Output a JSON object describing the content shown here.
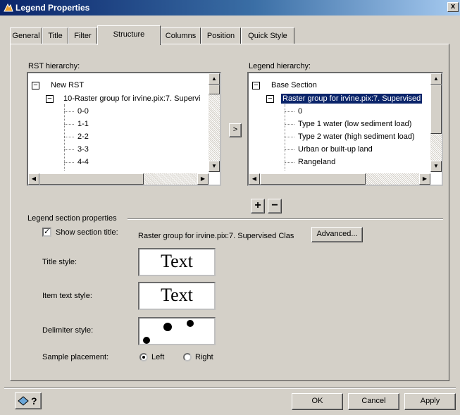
{
  "window": {
    "title": "Legend Properties",
    "close_glyph": "x"
  },
  "tabs": [
    {
      "label": "General"
    },
    {
      "label": "Title"
    },
    {
      "label": "Filter"
    },
    {
      "label": "Structure"
    },
    {
      "label": "Columns"
    },
    {
      "label": "Position"
    },
    {
      "label": "Quick Style"
    }
  ],
  "active_tab": "Structure",
  "rst": {
    "label": "RST hierarchy:",
    "root": "New RST",
    "group": "10-Raster group for irvine.pix:7. Supervi",
    "items": [
      "0-0",
      "1-1",
      "2-2",
      "3-3",
      "4-4"
    ]
  },
  "legend": {
    "label": "Legend hierarchy:",
    "root": "Base Section",
    "group": "Raster group for irvine.pix:7. Supervised",
    "items": [
      "0",
      "Type 1 water (low sediment load)",
      "Type 2 water (high sediment load)",
      "Urban or built-up land",
      "Rangeland"
    ]
  },
  "transfer_button": ">",
  "add_button": "+",
  "remove_button": "−",
  "section": {
    "heading": "Legend section properties",
    "show_title_label": "Show section title:",
    "show_title_checked": true,
    "section_title": "Raster group for irvine.pix:7. Supervised Clas",
    "advanced_label": "Advanced...",
    "title_style_label": "Title style:",
    "title_style_sample": "Text",
    "item_style_label": "Item text style:",
    "item_style_sample": "Text",
    "delimiter_label": "Delimiter style:",
    "placement_label": "Sample placement:",
    "placement_options": [
      "Left",
      "Right"
    ],
    "placement_selected": "Left"
  },
  "footer": {
    "help_icon": "help-pointer-icon",
    "help_glyph": "?",
    "ok_label": "OK",
    "cancel_label": "Cancel",
    "apply_label": "Apply"
  },
  "colors": {
    "titlebar_start": "#0a246a",
    "selection": "#0a246a",
    "face": "#d4d0c8"
  }
}
